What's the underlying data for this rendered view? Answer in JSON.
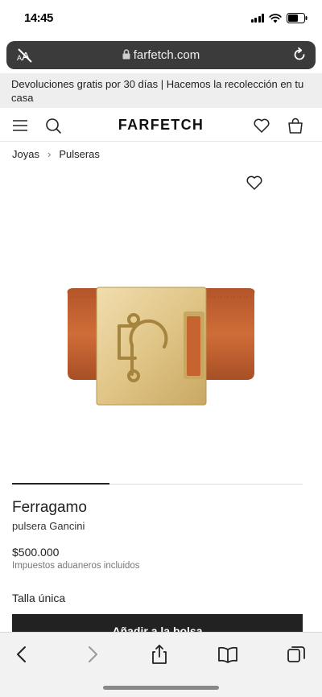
{
  "status_bar": {
    "time": "14:45"
  },
  "url_bar": {
    "domain": "farfetch.com"
  },
  "promo_banner": {
    "text": "Devoluciones gratis por 30 días | Hacemos la recolección en tu casa"
  },
  "header": {
    "logo": "FARFETCH"
  },
  "breadcrumb": {
    "items": [
      "Joyas",
      "Pulseras"
    ]
  },
  "product": {
    "brand": "Ferragamo",
    "name": "pulsera Gancini",
    "price": "$500.000",
    "tax_note": "Impuestos aduaneros incluidos",
    "size": "Talla única",
    "add_to_bag": "Añadir a la bolsa"
  },
  "colors": {
    "accent": "#222222",
    "leather": "#c5642f",
    "gold": "#e3c98a"
  },
  "icons": [
    "text-size-icon",
    "lock-icon",
    "reload-icon",
    "menu-icon",
    "search-icon",
    "heart-icon",
    "bag-icon",
    "back-icon",
    "forward-icon",
    "share-icon",
    "bookmarks-icon",
    "tabs-icon"
  ]
}
